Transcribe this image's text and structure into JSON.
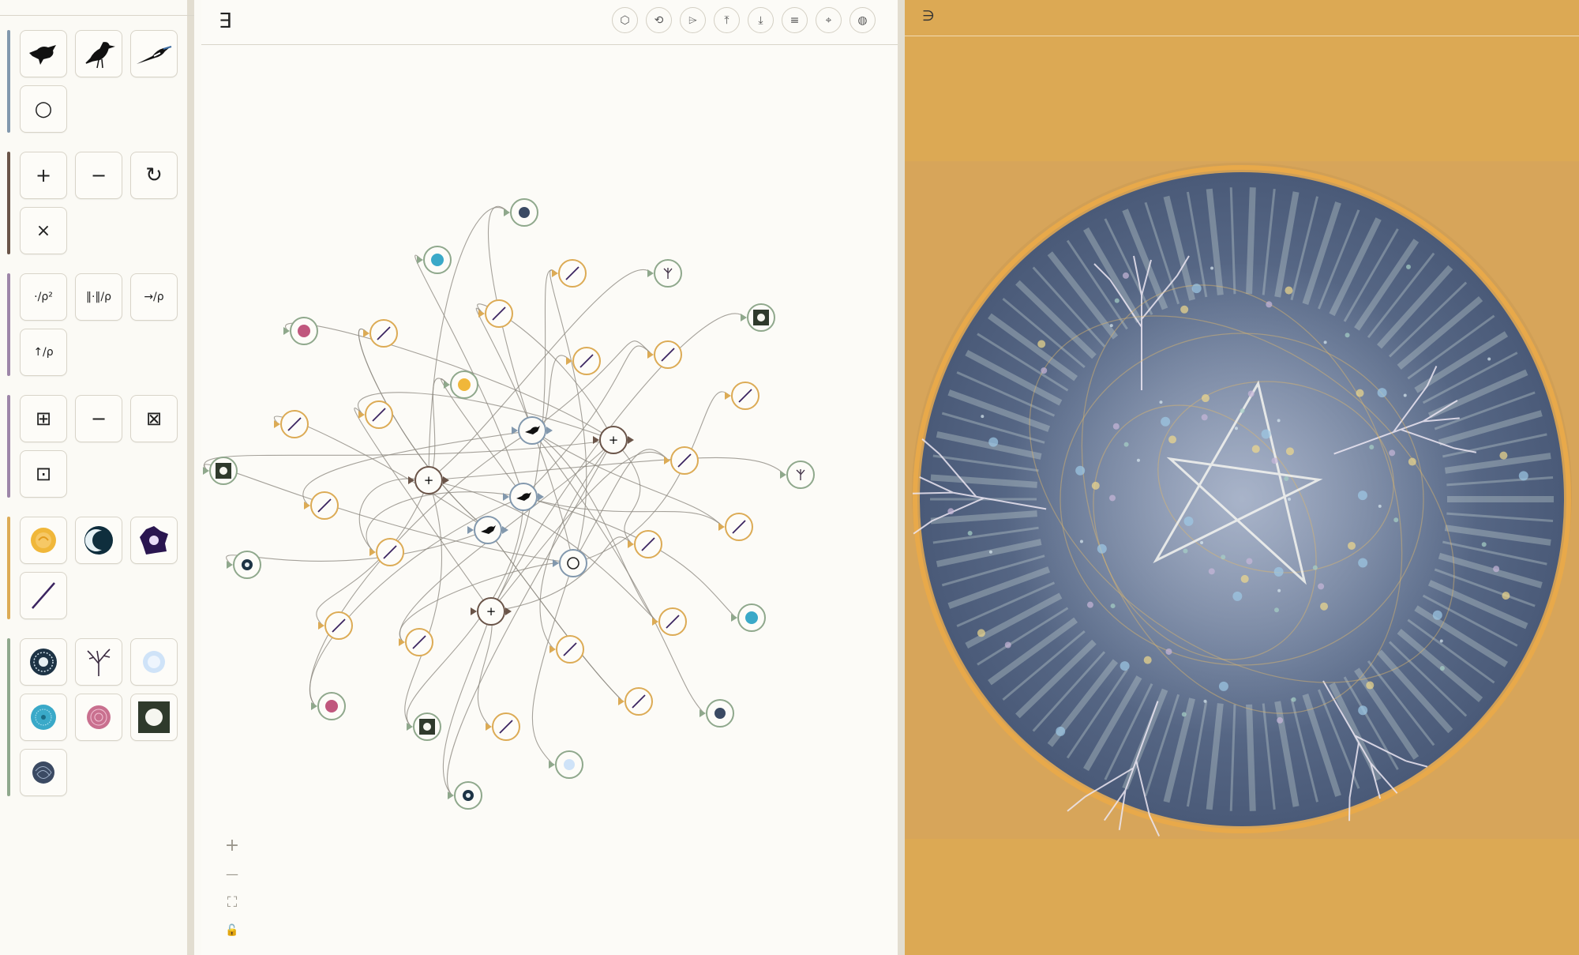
{
  "editor": {
    "header_glyph": "∃",
    "toolbar_buttons": [
      {
        "name": "hexagon-icon",
        "glyph": "⬡"
      },
      {
        "name": "undo-icon",
        "glyph": "⟲"
      },
      {
        "name": "play-icon",
        "glyph": "⌲"
      },
      {
        "name": "upload-icon",
        "glyph": "⤒"
      },
      {
        "name": "download-icon",
        "glyph": "⤓"
      },
      {
        "name": "menu-icon",
        "glyph": "≡"
      },
      {
        "name": "crosshair-icon",
        "glyph": "⌖"
      },
      {
        "name": "render-icon",
        "glyph": "◍"
      }
    ],
    "zoom_controls": [
      {
        "name": "zoom-in-button",
        "glyph": "+"
      },
      {
        "name": "zoom-out-button",
        "glyph": "—"
      },
      {
        "name": "fit-view-button",
        "glyph": "⛶"
      },
      {
        "name": "lock-button",
        "glyph": "🔓"
      }
    ]
  },
  "preview": {
    "header_glyph": "∋"
  },
  "palette": {
    "groups": [
      {
        "color": "#8298ad",
        "tiles": [
          {
            "name": "crow-icon"
          },
          {
            "name": "bird-standing-icon"
          },
          {
            "name": "magpie-icon"
          },
          {
            "name": "circle-icon",
            "glyph": "○"
          }
        ]
      },
      {
        "color": "#6a5448",
        "tiles": [
          {
            "name": "add-icon",
            "glyph": "+"
          },
          {
            "name": "subtract-icon",
            "glyph": "−"
          },
          {
            "name": "rotate-icon",
            "glyph": "↻"
          },
          {
            "name": "multiply-icon",
            "glyph": "×"
          }
        ]
      },
      {
        "color": "#9d86a8",
        "tiles": [
          {
            "name": "inverse-square-icon",
            "glyph": "·/ρ²"
          },
          {
            "name": "norm-icon",
            "glyph": "‖·‖/ρ"
          },
          {
            "name": "vector-icon",
            "glyph": "→/ρ"
          },
          {
            "name": "up-vector-icon",
            "glyph": "↑/ρ"
          }
        ]
      },
      {
        "color": "#9d86a8",
        "tiles": [
          {
            "name": "grid-plus-icon",
            "glyph": "⊞"
          },
          {
            "name": "minus-icon",
            "glyph": "−"
          },
          {
            "name": "grid-x-icon",
            "glyph": "⊠"
          },
          {
            "name": "grid-dot-icon",
            "glyph": "⊡"
          }
        ]
      },
      {
        "color": "#dcab55",
        "tiles": [
          {
            "name": "sun-icon"
          },
          {
            "name": "moon-icon"
          },
          {
            "name": "nebula-icon"
          },
          {
            "name": "line-icon"
          }
        ]
      },
      {
        "color": "#8fa88c",
        "tiles": [
          {
            "name": "mandala-icon"
          },
          {
            "name": "tree-icon"
          },
          {
            "name": "snowflake-icon"
          },
          {
            "name": "sunburst-icon"
          },
          {
            "name": "rosette-icon"
          },
          {
            "name": "dark-square-icon"
          },
          {
            "name": "scribble-icon"
          }
        ]
      }
    ]
  },
  "colors": {
    "accent_gold": "#dcab55",
    "bird_blue": "#8298ad",
    "op_brown": "#6a5448",
    "output_green": "#8fa88c",
    "teal": "#3aa9c8"
  }
}
